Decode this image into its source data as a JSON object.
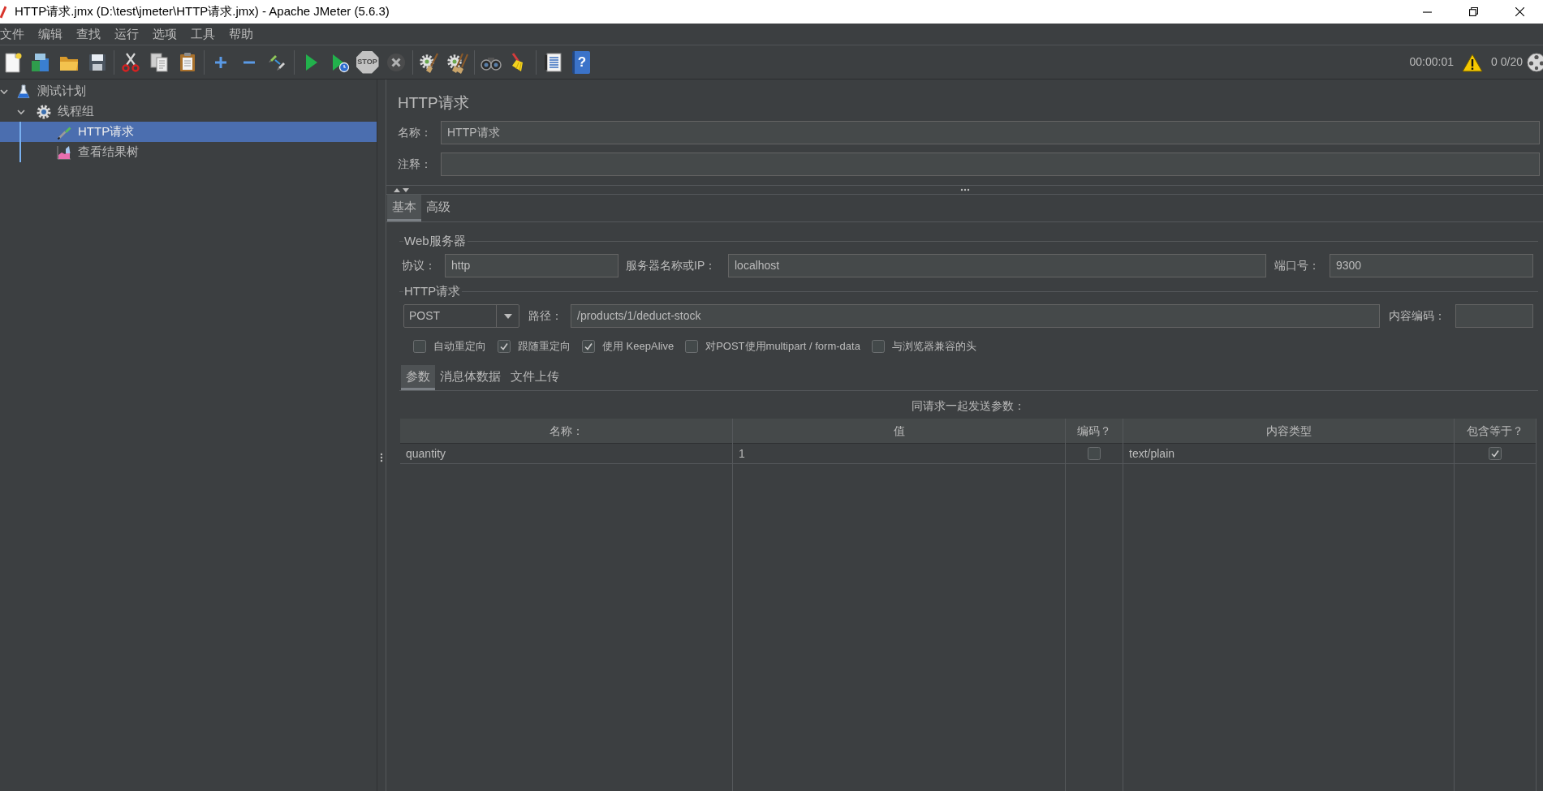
{
  "window": {
    "title": "HTTP请求.jmx (D:\\test\\jmeter\\HTTP请求.jmx) - Apache JMeter (5.6.3)"
  },
  "menu": [
    "文件",
    "编辑",
    "查找",
    "运行",
    "选项",
    "工具",
    "帮助"
  ],
  "toolbar": {
    "groups": [
      [
        {
          "kind": "new",
          "disabled": false
        },
        {
          "kind": "templates",
          "disabled": false
        },
        {
          "kind": "open",
          "disabled": false
        },
        {
          "kind": "save",
          "disabled": false
        }
      ],
      [
        {
          "kind": "cut",
          "disabled": false
        },
        {
          "kind": "copy",
          "disabled": false
        },
        {
          "kind": "paste",
          "disabled": false
        }
      ],
      [
        {
          "kind": "expand",
          "disabled": false
        },
        {
          "kind": "collapse",
          "disabled": false
        },
        {
          "kind": "toggle",
          "disabled": false
        }
      ],
      [
        {
          "kind": "start",
          "disabled": false
        },
        {
          "kind": "start_no_pause",
          "disabled": false
        },
        {
          "kind": "stop",
          "disabled": true,
          "label": "STOP"
        },
        {
          "kind": "shutdown",
          "disabled": true
        }
      ],
      [
        {
          "kind": "clear",
          "disabled": false
        },
        {
          "kind": "clear_all",
          "disabled": false
        }
      ],
      [
        {
          "kind": "search",
          "disabled": false
        },
        {
          "kind": "reset_search",
          "disabled": false
        }
      ],
      [
        {
          "kind": "function_helper",
          "disabled": false
        },
        {
          "kind": "help",
          "disabled": false,
          "label": "?"
        }
      ]
    ],
    "elapsed": "00:00:01",
    "warnings": "0",
    "threads": "0/20"
  },
  "tree": [
    {
      "kind": "test_plan",
      "label": "测试计划",
      "expanded": true,
      "selected": false,
      "children": [
        {
          "kind": "thread_group",
          "label": "线程组",
          "expanded": true,
          "selected": false,
          "children": [
            {
              "kind": "sampler",
              "label": "HTTP请求",
              "selected": true
            },
            {
              "kind": "listener",
              "label": "查看结果树",
              "selected": false
            }
          ]
        }
      ]
    }
  ],
  "editor": {
    "title": "HTTP请求",
    "name": {
      "label": "名称：",
      "value": "HTTP请求"
    },
    "comment": {
      "label": "注释："
    },
    "tabs": [
      {
        "label": "基本",
        "selected": true
      },
      {
        "label": "高级",
        "selected": false
      }
    ],
    "web_server": {
      "title": "Web服务器",
      "fields": [
        {
          "label": "协议：",
          "value": "http"
        },
        {
          "label": "服务器名称或IP：",
          "value": "localhost"
        },
        {
          "label": "端口号：",
          "value": "9300"
        }
      ]
    },
    "http_request": {
      "title": "HTTP请求",
      "method": "POST",
      "path": {
        "label": "路径：",
        "value": "/products/1/deduct-stock"
      },
      "encoding": {
        "label": "内容编码："
      },
      "options": [
        {
          "label": "自动重定向",
          "checked": false
        },
        {
          "label": "跟随重定向",
          "checked": true
        },
        {
          "label": "使用 KeepAlive",
          "checked": true
        },
        {
          "label": "对POST使用multipart / form-data",
          "checked": false
        },
        {
          "label": "与浏览器兼容的头",
          "checked": false
        }
      ]
    },
    "sub_tabs": [
      {
        "label": "参数",
        "selected": true
      },
      {
        "label": "消息体数据",
        "selected": false
      },
      {
        "label": "文件上传",
        "selected": false
      }
    ],
    "parameters": {
      "caption": "同请求一起发送参数：",
      "columns": [
        "名称：",
        "值",
        "编码？",
        "内容类型",
        "包含等于？"
      ],
      "rows": [
        {
          "cells": [
            {
              "kind": "text",
              "text": "quantity"
            },
            {
              "kind": "text",
              "text": "1"
            },
            {
              "kind": "checkbox",
              "checked": false
            },
            {
              "kind": "text",
              "text": "text/plain"
            },
            {
              "kind": "checkbox",
              "checked": true
            }
          ]
        }
      ]
    }
  }
}
